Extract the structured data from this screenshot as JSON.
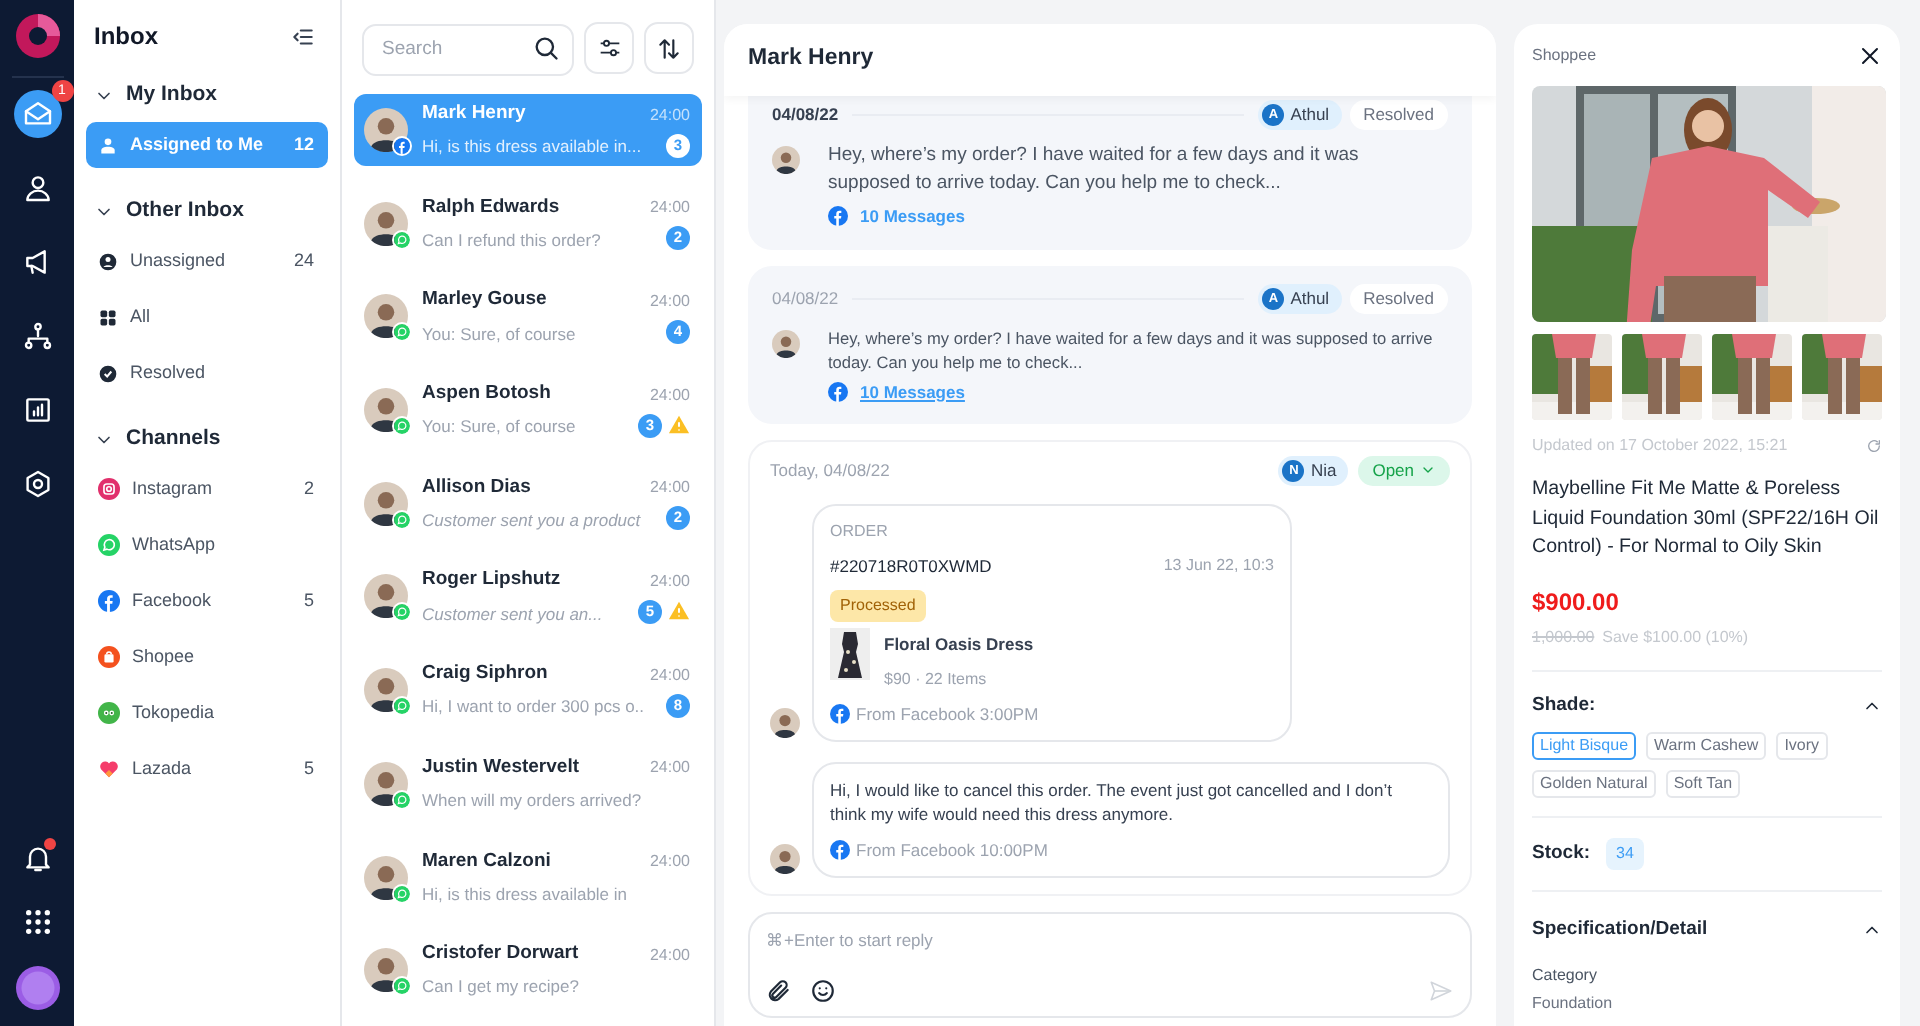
{
  "rail": {
    "items": [
      {
        "kind": "inbox",
        "selected": true,
        "badge": "1"
      },
      {
        "kind": "contacts",
        "selected": false
      },
      {
        "kind": "campaigns",
        "selected": false
      },
      {
        "kind": "flows",
        "selected": false
      },
      {
        "kind": "reports",
        "selected": false
      },
      {
        "kind": "settings",
        "selected": false
      }
    ],
    "bottom": [
      {
        "kind": "notifications",
        "alert": true
      },
      {
        "kind": "apps",
        "alert": false
      }
    ]
  },
  "inbox_nav": {
    "title": "Inbox",
    "sections": [
      {
        "title": "My Inbox",
        "expanded": true,
        "items": [
          {
            "kind": "assigned",
            "label": "Assigned to Me",
            "count": "12",
            "selected": true
          }
        ]
      },
      {
        "title": "Other Inbox",
        "expanded": true,
        "items": [
          {
            "kind": "unassigned",
            "label": "Unassigned",
            "count": "24",
            "selected": false
          },
          {
            "kind": "all",
            "label": "All",
            "selected": false
          },
          {
            "kind": "resolved",
            "label": "Resolved",
            "selected": false
          }
        ]
      },
      {
        "title": "Channels",
        "expanded": true,
        "items": [
          {
            "kind": "instagram",
            "label": "Instagram",
            "count": "2",
            "selected": false
          },
          {
            "kind": "whatsapp",
            "label": "WhatsApp",
            "selected": false
          },
          {
            "kind": "facebook",
            "label": "Facebook",
            "count": "5",
            "selected": false
          },
          {
            "kind": "shopee",
            "label": "Shopee",
            "selected": false
          },
          {
            "kind": "tokopedia",
            "label": "Tokopedia",
            "selected": false
          },
          {
            "kind": "lazada",
            "label": "Lazada",
            "count": "5",
            "selected": false
          }
        ]
      }
    ]
  },
  "conversation_list": {
    "search": {
      "placeholder": "Search"
    },
    "conversations": [
      {
        "name": "Mark Henry",
        "preview": "Hi, is this dress available in...",
        "time": "24:00",
        "unread": "3",
        "kind": "facebook",
        "warning": false,
        "system": false,
        "selected": true
      },
      {
        "name": "Ralph Edwards",
        "preview": "Can I refund this order?",
        "time": "24:00",
        "unread": "2",
        "kind": "whatsapp",
        "warning": false,
        "system": false,
        "selected": false
      },
      {
        "name": "Marley Gouse",
        "preview": "You: Sure, of course",
        "time": "24:00",
        "unread": "4",
        "kind": "whatsapp",
        "warning": false,
        "system": false,
        "selected": false
      },
      {
        "name": "Aspen Botosh",
        "preview": "You: Sure, of course",
        "time": "24:00",
        "unread": "3",
        "kind": "whatsapp",
        "warning": true,
        "system": false,
        "selected": false
      },
      {
        "name": "Allison Dias",
        "preview": "Customer sent you a product",
        "time": "24:00",
        "unread": "2",
        "kind": "whatsapp",
        "warning": false,
        "system": true,
        "selected": false
      },
      {
        "name": "Roger Lipshutz",
        "preview": "Customer sent you an...",
        "time": "24:00",
        "unread": "5",
        "kind": "whatsapp",
        "warning": true,
        "system": true,
        "selected": false
      },
      {
        "name": "Craig Siphron",
        "preview": "Hi, I want to order 300 pcs o..",
        "time": "24:00",
        "unread": "8",
        "kind": "whatsapp",
        "warning": false,
        "system": false,
        "selected": false
      },
      {
        "name": "Justin Westervelt",
        "preview": "When will my orders arrived?",
        "time": "24:00",
        "kind": "whatsapp",
        "warning": false,
        "system": false,
        "selected": false
      },
      {
        "name": "Maren Calzoni",
        "preview": "Hi, is this dress available in",
        "time": "24:00",
        "kind": "whatsapp",
        "warning": false,
        "system": false,
        "selected": false
      },
      {
        "name": "Cristofer Dorwart",
        "preview": "Can I get my recipe?",
        "time": "24:00",
        "kind": "whatsapp",
        "warning": false,
        "system": false,
        "selected": false
      }
    ]
  },
  "conversation": {
    "title": "Mark Henry",
    "threads": [
      {
        "kind": "summary",
        "date": "04/08/22",
        "emphasis": true,
        "agent": {
          "initial": "A",
          "name": "Athul"
        },
        "status": {
          "kind": "resolved",
          "label": "Resolved"
        },
        "message": "Hey, where’s my order? I have waited for a few days and it was supposed to arrive today. Can you help me to check...",
        "link": {
          "kind": "facebook",
          "label": "10 Messages",
          "underlined": false
        }
      },
      {
        "kind": "summary",
        "date": "04/08/22",
        "emphasis": false,
        "agent": {
          "initial": "A",
          "name": "Athul"
        },
        "status": {
          "kind": "resolved",
          "label": "Resolved"
        },
        "message": "Hey, where’s my order? I have waited for a few days and it was supposed to arrive today. Can you help me to check...",
        "link": {
          "kind": "facebook",
          "label": "10 Messages",
          "underlined": true
        }
      },
      {
        "kind": "detail",
        "date": "Today, 04/08/22",
        "agent": {
          "initial": "N",
          "name": "Nia"
        },
        "status": {
          "kind": "open",
          "label": "Open"
        },
        "messages": [
          {
            "kind": "order",
            "label": "ORDER",
            "number": "#220718R0T0XWMD",
            "time": "13 Jun 22, 10:3",
            "badge": "Processed",
            "product": "Floral Oasis Dress",
            "meta": "$90 · 22 Items",
            "source": "From Facebook",
            "at": "3:00PM"
          },
          {
            "kind": "text",
            "text": "Hi, I would like to cancel this order. The event just got cancelled and I don’t think my wife would need this dress anymore.",
            "source": "From Facebook",
            "at": "10:00PM"
          }
        ]
      }
    ],
    "reply": {
      "placeholder": "⌘+Enter to start reply"
    }
  },
  "product_panel": {
    "store": "Shoppee",
    "updated": "Updated on 17 October 2022, 15:21",
    "title": "Maybelline Fit Me Matte & Poreless Liquid Foundation 30ml (SPF22/16H Oil Control) - For Normal to Oily Skin",
    "price": "$900.00",
    "original_price": "1,000.00",
    "saving": "Save $100.00 (10%)",
    "shade": {
      "title": "Shade:",
      "expanded": true,
      "options": [
        {
          "label": "Light Bisque",
          "selected": true
        },
        {
          "label": "Warm Cashew",
          "selected": false
        },
        {
          "label": "Ivory",
          "selected": false
        },
        {
          "label": "Golden Natural",
          "selected": false
        },
        {
          "label": "Soft Tan",
          "selected": false
        }
      ]
    },
    "stock": {
      "label": "Stock:",
      "value": "34"
    },
    "specification": {
      "title": "Specification/Detail",
      "expanded": true,
      "fields": [
        {
          "label": "Category",
          "value": "Foundation"
        }
      ]
    }
  }
}
